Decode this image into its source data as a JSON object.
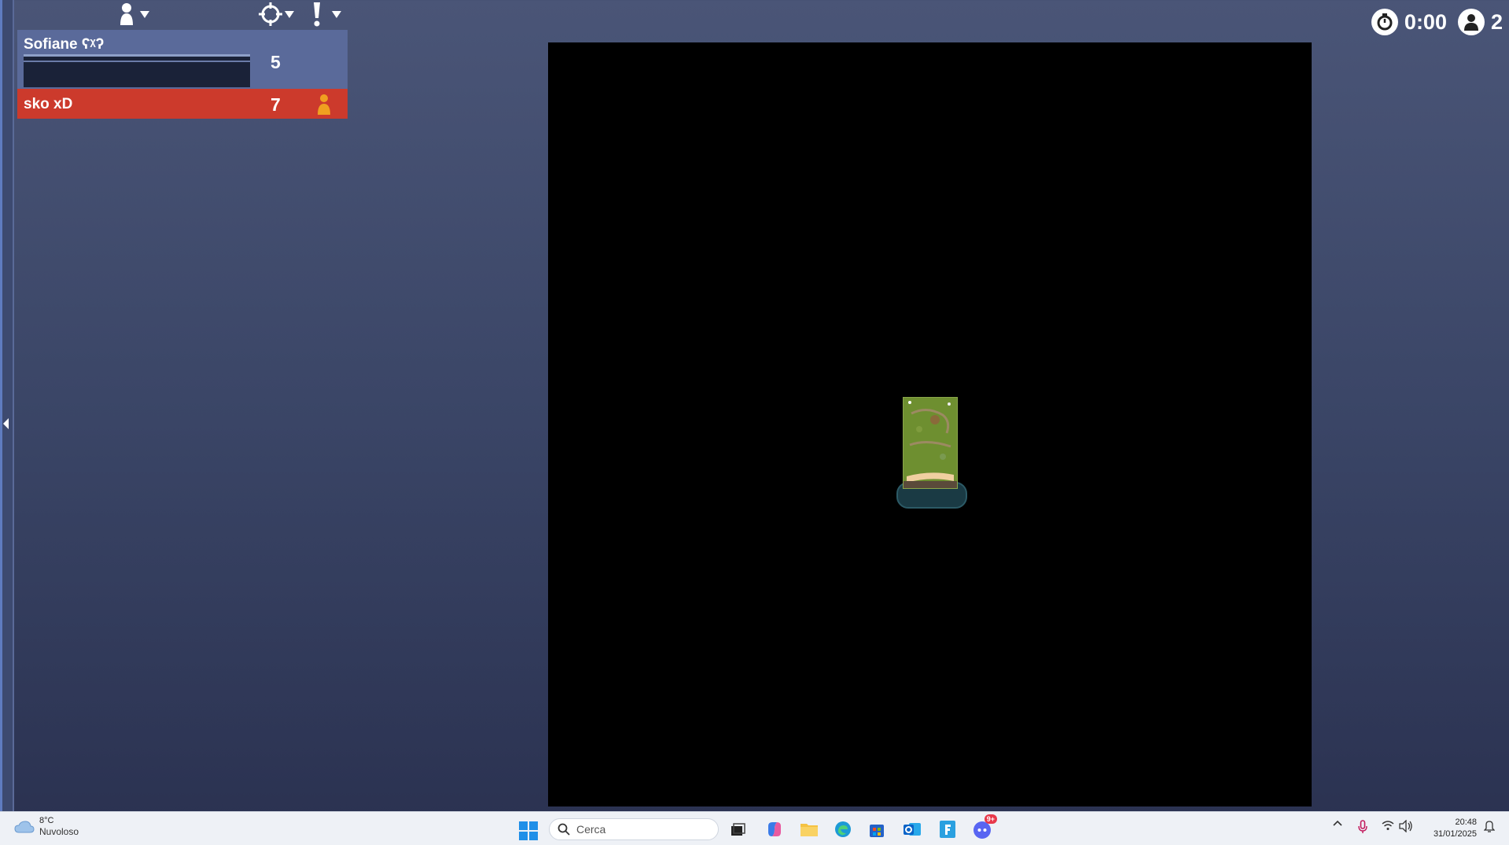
{
  "scoreboard": {
    "players": [
      {
        "name": "Sofiane ʕᵡʔ",
        "score": "5",
        "progress": 0
      },
      {
        "name": "sko xD",
        "score": "7"
      }
    ]
  },
  "hud": {
    "timer": "0:00",
    "player_count": "2"
  },
  "taskbar": {
    "weather_temp": "8°C",
    "weather_desc": "Nuvoloso",
    "search_placeholder": "Cerca",
    "time": "20:48",
    "date": "31/01/2025",
    "discord_badge": "9+"
  },
  "colors": {
    "accent": "#5a6a9a",
    "opponent": "#cc3a2c",
    "board": "#000000"
  }
}
